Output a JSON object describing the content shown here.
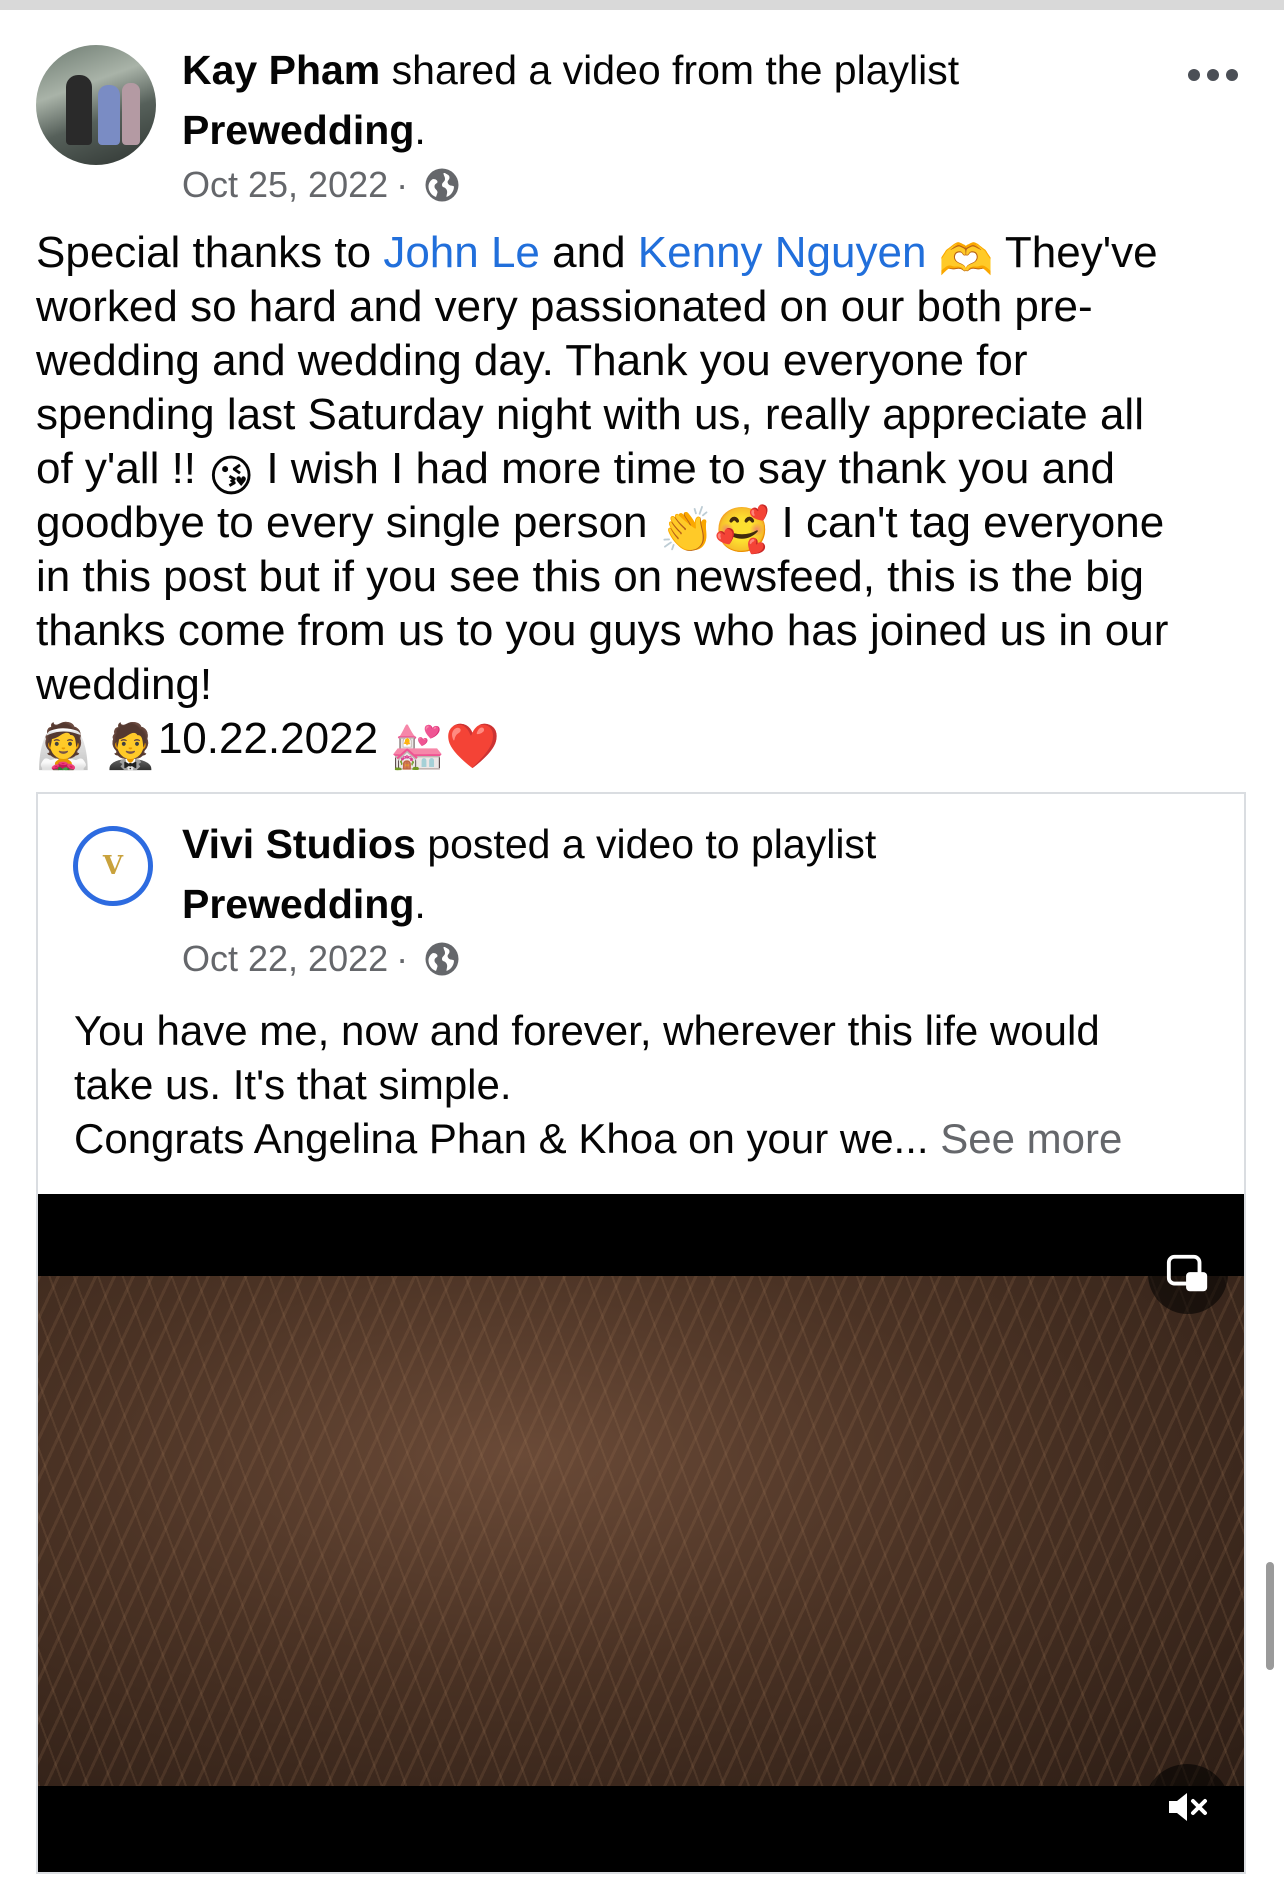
{
  "post": {
    "author": "Kay Pham",
    "action": "shared a video from the playlist",
    "playlist": "Prewedding",
    "period": ".",
    "date": "Oct 25, 2022",
    "separator": "·",
    "more_icon": "more-horizontal-icon",
    "privacy_icon": "globe-icon"
  },
  "body": {
    "r1_a": "Special thanks to ",
    "mention_1": "John Le",
    "r1_b": " and ",
    "mention_2": "Kenny Nguyen",
    "r1_c": "They've",
    "r2": "worked so hard and very passionated on our both pre-",
    "r3": "wedding and wedding day. Thank you everyone for",
    "r4": "spending last Saturday night with us, really appreciate all",
    "r5_a": "of y'all !! ",
    "r5_b": " I wish I had more time to say thank you and",
    "r6_a": "goodbye to every single person ",
    "r6_b": " I can't tag everyone",
    "r7": "in this post but if you see this on newsfeed, this is the big",
    "r8": "thanks come from us to you guys who has joined us in our",
    "r9": "wedding!",
    "date_line": "10.22.2022",
    "emoji_heart_hands": "🫶",
    "emoji_kiss": "😘",
    "emoji_clap": "👏",
    "emoji_smiling_hearts": "🥰",
    "emoji_groom": "👰",
    "emoji_bride": "🤵",
    "emoji_chapel": "💒",
    "emoji_heart": "❤️"
  },
  "shared": {
    "author": "Vivi Studios",
    "action": "posted a video to playlist",
    "playlist": "Prewedding",
    "period": ".",
    "date": "Oct 22, 2022",
    "separator": "·",
    "avatar_letter": "V",
    "t1": "You have me, now and forever, wherever this life would",
    "t2": "take us. It's that simple.",
    "t3": "Congrats Angelina Phan & Khoa on your we... ",
    "see_more": "See more"
  },
  "video": {
    "pip_icon": "picture-in-picture-icon",
    "mute_icon": "volume-muted-icon"
  },
  "colors": {
    "link": "#216fdb",
    "secondary_text": "#65676b",
    "card_border": "#dadde1",
    "avatar_ring": "#2d6be0"
  }
}
